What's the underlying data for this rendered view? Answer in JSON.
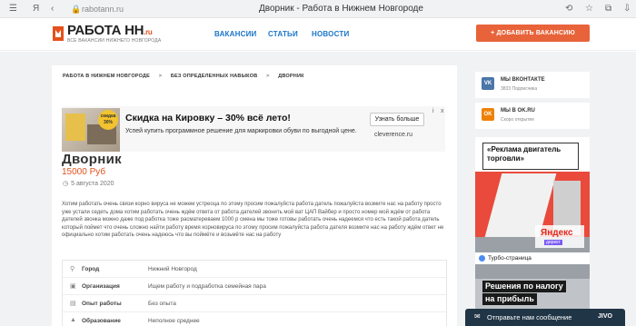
{
  "browser": {
    "url": "rabotann.ru",
    "title": "Дворник - Работа в Нижнем Новгороде"
  },
  "header": {
    "logo_text": "РАБОТА НН",
    "logo_tld": ".ru",
    "logo_sub": "ВСЕ ВАКАНСИИ НИЖНЕГО НОВГОРОДА",
    "nav": [
      "ВАКАНСИИ",
      "СТАТЬИ",
      "НОВОСТИ"
    ],
    "add_button": "+ ДОБАВИТЬ ВАКАНСИЮ",
    "accent": "#e8633a"
  },
  "breadcrumb": [
    "РАБОТА В НИЖНЕМ НОВГОРОДЕ",
    ">",
    "БЕЗ ОПРЕДЕЛЕННЫХ НАВЫКОВ",
    ">",
    "ДВОРНИК"
  ],
  "ad": {
    "badge": "скидка 30%",
    "title": "Скидка на Кировку – 30% всё лето!",
    "desc": "Успей купить программное решение для маркировки обуви по выгодной цене.",
    "button": "Узнать больше",
    "domain": "cleverence.ru",
    "info": "i",
    "close": "x"
  },
  "vacancy": {
    "title": "Дворник",
    "salary": "15000 Руб",
    "date": "5 августа 2020",
    "description": "Хотим работать очень связи корно вируса не можем устреоца по этому просим пожалуйста работа датель пожалуйста возмите нас на работу просто уже устали седеть дома хотим работать очень ждём ответа от работа дателей звонить мой ват ЦАП Вайбер и просто номер мой ждём от работа дателей звонка можно даже под работка тоже расматереваем 1000 р смена мы тоже готовы работать очень надеемся что есть такой работа датель который поймет что очень сложно найти работу время корновируса по этому просим пожалуйста работа дателя возмите нас на работу ждём ответ не официально хотим работать очень надеюсь что вы поймёте и возьмёте нас на работу"
  },
  "info_rows": [
    {
      "icon": "location-icon",
      "label": "Город",
      "value": "Нижний Новгород"
    },
    {
      "icon": "building-icon",
      "label": "Организация",
      "value": "Ищем работу и подработка семейная пара"
    },
    {
      "icon": "briefcase-icon",
      "label": "Опыт работы",
      "value": "Без опыта"
    },
    {
      "icon": "education-icon",
      "label": "Образование",
      "value": "Неполное среднее"
    }
  ],
  "sidebar": {
    "vk": {
      "icon_text": "VK",
      "name": "МЫ ВКОНТАКТЕ",
      "sub": "3833 Подписчика",
      "color": "#4a76a8"
    },
    "ok": {
      "icon_text": "OK",
      "name": "МЫ В OK.RU",
      "sub": "Скоро открытие",
      "color": "#ee8208"
    }
  },
  "side_ad": {
    "bubble": "«Реклама двигатель торговли»",
    "yandex": "Яндекс",
    "yandex_sub": "директ",
    "turbo": "Турбо-страница",
    "bottom_line1": "Решения по налогу",
    "bottom_line2": "на прибыль"
  },
  "chat": {
    "text": "Отправьте нам сообщение",
    "brand": "JIVO"
  }
}
